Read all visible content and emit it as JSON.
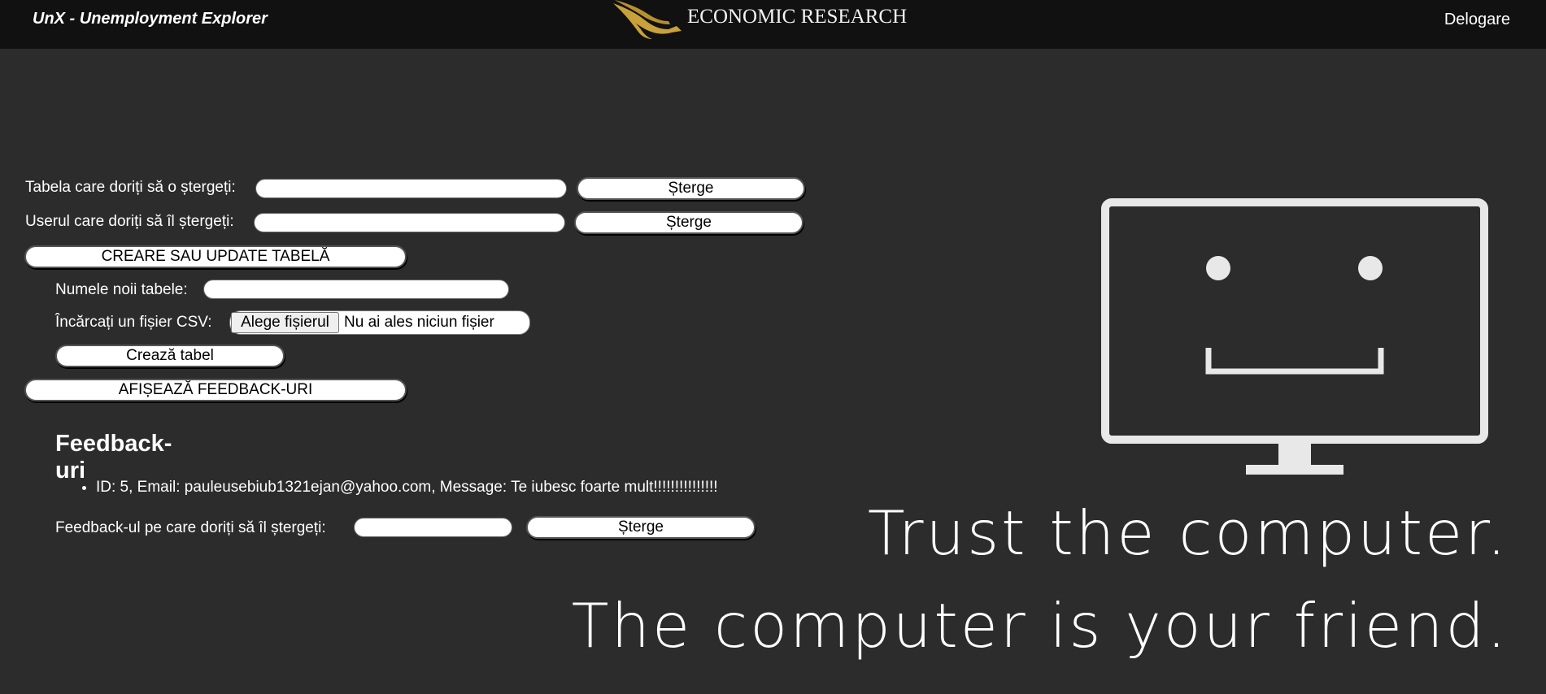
{
  "header": {
    "app_title": "UnX - Unemployment Explorer",
    "logo_text": "ECONOMIC RESEARCH",
    "logout_label": "Delogare",
    "logo_color": "#c9a13b"
  },
  "delete_table": {
    "label": "Tabela care doriți să o ștergeți:",
    "value": "",
    "button": "Șterge"
  },
  "delete_user": {
    "label": "Userul care doriți să îl ștergeți:",
    "value": "",
    "button": "Șterge"
  },
  "create_section": {
    "toggle_button": "CREARE SAU UPDATE TABELĂ",
    "table_name_label": "Numele noii tabele:",
    "table_name_value": "",
    "csv_label": "Încărcați un fișier CSV:",
    "file_button": "Alege fișierul",
    "file_status": "Nu ai ales niciun fișier",
    "create_button": "Crează tabel"
  },
  "feedback": {
    "toggle_button": "AFIȘEAZĂ FEEDBACK-URI",
    "heading": "Feedback-uri",
    "items": [
      "ID: 5, Email: pauleusebiub1321ejan@yahoo.com, Message: Te iubesc foarte mult!!!!!!!!!!!!!!!"
    ],
    "delete_label": "Feedback-ul pe care doriți să îl ștergeți:",
    "delete_value": "",
    "delete_button": "Șterge"
  },
  "illustration": {
    "icon": "computer-monitor-smiley-icon",
    "line1": "Trust the computer.",
    "line2": "The computer is your friend."
  }
}
